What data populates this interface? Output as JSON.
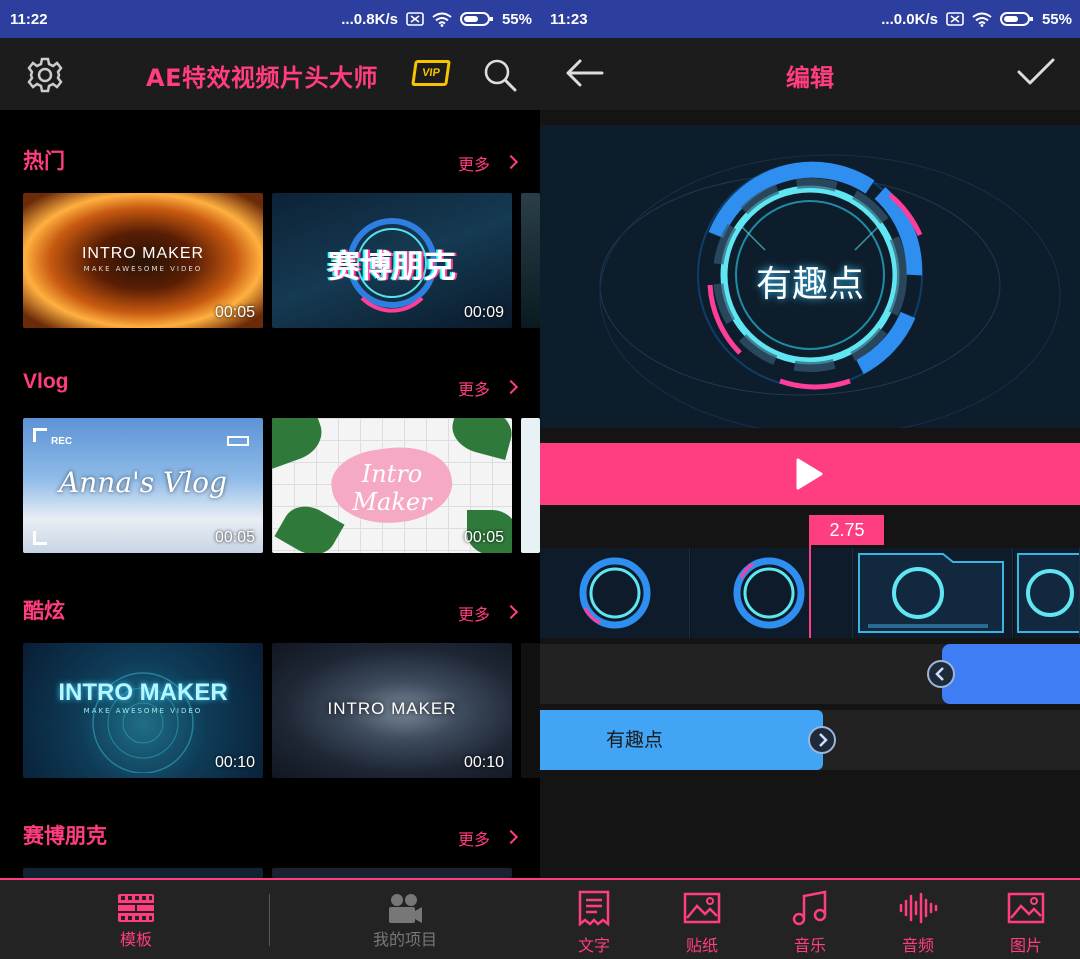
{
  "left": {
    "status": {
      "time": "11:22",
      "speed": "...0.8K/s",
      "battery": "55%"
    },
    "header": {
      "title": "AE特效视频片头大师",
      "vip": "VIP"
    },
    "sections": [
      {
        "title": "热门",
        "more": "更多",
        "items": [
          {
            "title": "INTRO MAKER",
            "subtitle": "MAKE AWESOME VIDEO",
            "duration": "00:05"
          },
          {
            "title": "赛博朋克",
            "duration": "00:09"
          }
        ]
      },
      {
        "title": "Vlog",
        "more": "更多",
        "items": [
          {
            "title": "Anna's Vlog",
            "badge": "REC",
            "duration": "00:05"
          },
          {
            "title": "Intro Maker",
            "duration": "00:05"
          }
        ]
      },
      {
        "title": "酷炫",
        "more": "更多",
        "items": [
          {
            "title": "INTRO MAKER",
            "subtitle": "MAKE AWESOME VIDEO",
            "duration": "00:10"
          },
          {
            "title": "INTRO MAKER",
            "duration": "00:10"
          }
        ]
      },
      {
        "title": "赛博朋克",
        "more": "更多"
      }
    ],
    "tabs": [
      {
        "label": "模板",
        "icon": "film-icon",
        "active": true
      },
      {
        "label": "我的项目",
        "icon": "camera-icon",
        "active": false
      }
    ]
  },
  "right": {
    "status": {
      "time": "11:23",
      "speed": "...0.0K/s",
      "battery": "55%"
    },
    "header": {
      "title": "编辑"
    },
    "preview_text": "有趣点",
    "timeline": {
      "time": "2.75",
      "text_clip": "有趣点"
    },
    "tools": [
      {
        "label": "文字",
        "icon": "text-doc-icon"
      },
      {
        "label": "贴纸",
        "icon": "sticker-icon"
      },
      {
        "label": "音乐",
        "icon": "music-icon"
      },
      {
        "label": "音频",
        "icon": "audio-wave-icon"
      },
      {
        "label": "图片",
        "icon": "image-icon"
      }
    ]
  },
  "colors": {
    "accent": "#ff3d7f",
    "status_bar": "#2d3f9e",
    "vip": "#f6c400",
    "clip_blue": "#42a4f5"
  }
}
